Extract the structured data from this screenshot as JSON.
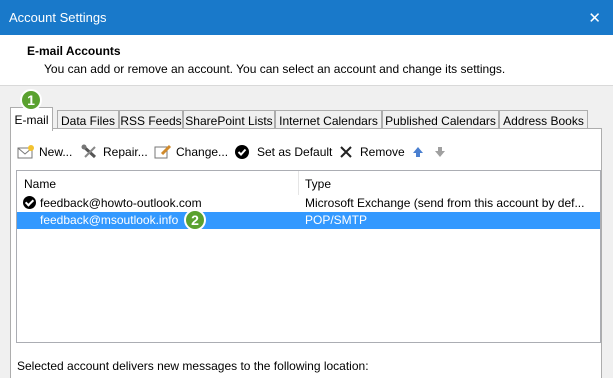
{
  "window": {
    "title": "Account Settings",
    "close": "✕"
  },
  "header": {
    "title": "E-mail Accounts",
    "subtitle": "You can add or remove an account. You can select an account and change its settings."
  },
  "tabs": [
    {
      "label": "E-mail"
    },
    {
      "label": "Data Files"
    },
    {
      "label": "RSS Feeds"
    },
    {
      "label": "SharePoint Lists"
    },
    {
      "label": "Internet Calendars"
    },
    {
      "label": "Published Calendars"
    },
    {
      "label": "Address Books"
    }
  ],
  "toolbar": {
    "new_label": "New...",
    "repair_label": "Repair...",
    "change_label": "Change...",
    "default_label": "Set as Default",
    "remove_label": "Remove"
  },
  "list": {
    "col_name": "Name",
    "col_type": "Type",
    "rows": [
      {
        "name": "feedback@howto-outlook.com",
        "type": "Microsoft Exchange (send from this account by def..."
      },
      {
        "name": "feedback@msoutlook.info",
        "type": "POP/SMTP"
      }
    ]
  },
  "badges": {
    "one": "1",
    "two": "2"
  },
  "footer": {
    "text": "Selected account delivers new messages to the following location:"
  },
  "colors": {
    "titlebar": "#1979ca",
    "selection": "#3399ff",
    "badge": "#5aa12f"
  }
}
